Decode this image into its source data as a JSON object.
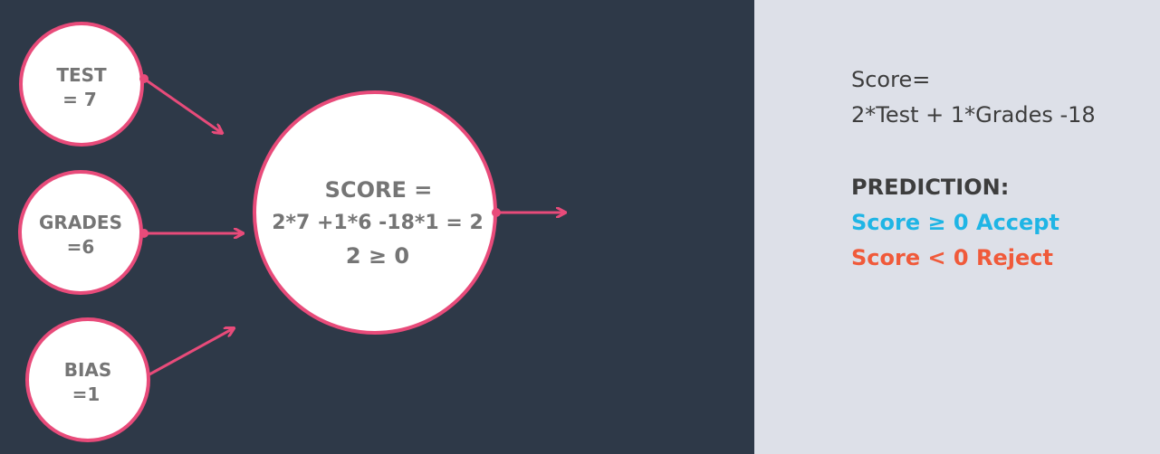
{
  "colors": {
    "left_background": "#2e3948",
    "right_background": "#dde0e8",
    "node_fill": "#ffffff",
    "node_border": "#e84b7a",
    "edge": "#e84b7a",
    "node_text": "#757575",
    "accept": "#1fb5e5",
    "reject": "#f05a3a"
  },
  "nodes": {
    "test": {
      "line1": "TEST",
      "line2": "= 7"
    },
    "grades": {
      "line1": "GRADES",
      "line2": "=6"
    },
    "bias": {
      "line1": "BIAS",
      "line2": "=1"
    },
    "score": {
      "line1": "SCORE =",
      "line2": "2*7 +1*6 -18*1 = 2",
      "line3": "2 ≥ 0"
    }
  },
  "formula": {
    "line1": "Score=",
    "line2": "2*Test + 1*Grades -18"
  },
  "prediction": {
    "title": "PREDICTION:",
    "accept": "Score ≥ 0 Accept",
    "reject": "Score < 0 Reject"
  }
}
